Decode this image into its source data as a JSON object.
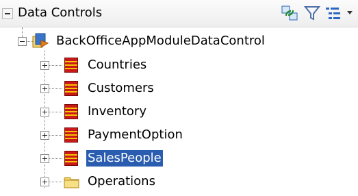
{
  "panel": {
    "title": "Data Controls",
    "toolbar_icons": [
      "refresh-icon",
      "filter-icon",
      "view-options-icon"
    ]
  },
  "tree": {
    "root": {
      "label": "BackOfficeAppModuleDataControl",
      "icon": "data-control-icon",
      "expanded": true
    },
    "children": [
      {
        "label": "Countries",
        "icon": "collection-icon",
        "selected": false
      },
      {
        "label": "Customers",
        "icon": "collection-icon",
        "selected": false
      },
      {
        "label": "Inventory",
        "icon": "collection-icon",
        "selected": false
      },
      {
        "label": "PaymentOption",
        "icon": "collection-icon",
        "selected": false
      },
      {
        "label": "SalesPeople",
        "icon": "collection-icon",
        "selected": true
      },
      {
        "label": "Operations",
        "icon": "folder-icon",
        "selected": false
      }
    ]
  },
  "colors": {
    "selection": "#2a5db0",
    "collection": "#c81818",
    "folder": "#f1d36a"
  }
}
